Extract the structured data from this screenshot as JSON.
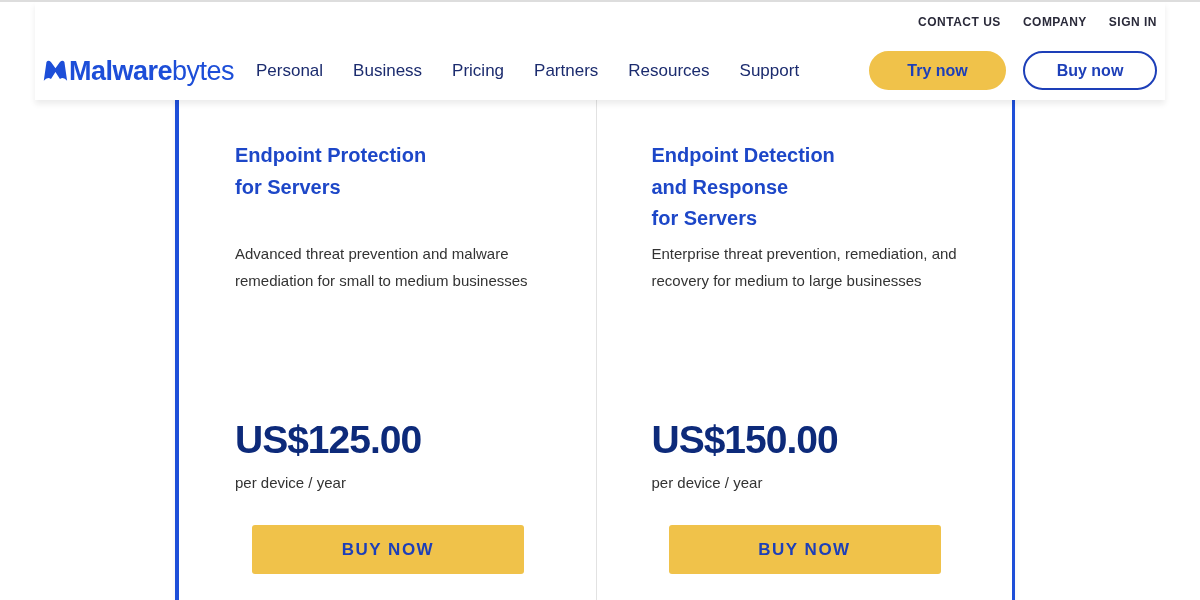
{
  "header": {
    "logo": "**Malware**bytes",
    "utility_links": [
      "CONTACT US",
      "COMPANY",
      "SIGN IN"
    ],
    "nav": [
      "Personal",
      "Business",
      "Pricing",
      "Partners",
      "Resources",
      "Support"
    ],
    "buttons": [
      {
        "kind": "primary",
        "label": "Try now"
      },
      {
        "kind": "outline",
        "label": "Buy now"
      }
    ]
  },
  "plans": [
    {
      "title": [
        "Endpoint Protection",
        "for Servers"
      ],
      "description": "Advanced threat prevention and malware remediation for small to medium businesses",
      "price": "US$125.00",
      "period": "per device / year",
      "button": "BUY NOW"
    },
    {
      "title": [
        "Endpoint Detection",
        "and Response",
        "for Servers"
      ],
      "description": "Enterprise threat prevention, remediation, and recovery for medium to large businesses",
      "price": "US$150.00",
      "period": "per device / year",
      "button": "BUY NOW"
    }
  ]
}
